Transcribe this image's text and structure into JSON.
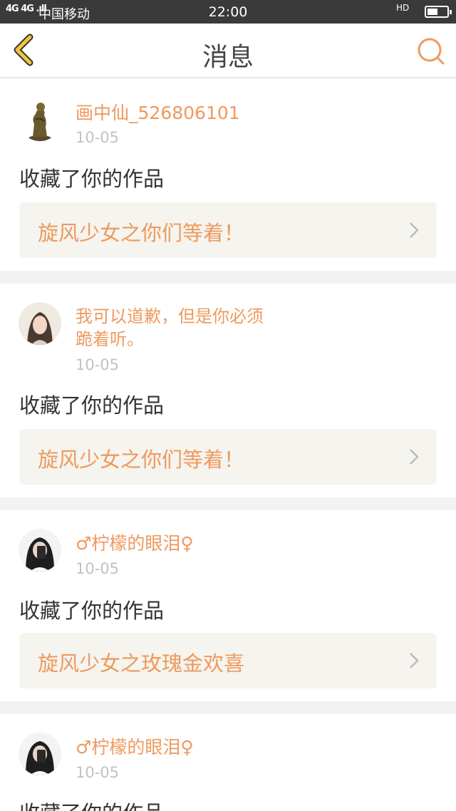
{
  "status_bar": {
    "signal": "4G 4G .ıll",
    "carrier": "中国移动",
    "time": "22:00",
    "hd": "HD",
    "battery_level": 0.55
  },
  "nav": {
    "back_icon": "back-chevron-icon",
    "title": "消息",
    "search_icon": "search-icon"
  },
  "colors": {
    "accent": "#ee9a5e",
    "back": "#f2c43e",
    "card_inner": "#f5f4ef"
  },
  "messages": [
    {
      "user": "画中仙_526806101",
      "date": "10-05",
      "action": "收藏了你的作品",
      "work": "旋风少女之你们等着！",
      "avatar": "statue-avatar"
    },
    {
      "user": "我可以道歉，但是你必须跪着听。",
      "user_line1": "我可以道歉，但是你必须",
      "user_line2": "跪着听。",
      "date": "10-05",
      "action": "收藏了你的作品",
      "work": "旋风少女之你们等着！",
      "avatar": "girl-avatar"
    },
    {
      "user": "♂柠檬的眼泪♀",
      "date": "10-05",
      "action": "收藏了你的作品",
      "work": "旋风少女之玫瑰金欢喜",
      "avatar": "girl-phone-avatar"
    },
    {
      "user": "♂柠檬的眼泪♀",
      "date": "10-05",
      "action": "收藏了你的作品",
      "avatar": "girl-phone-avatar"
    }
  ]
}
